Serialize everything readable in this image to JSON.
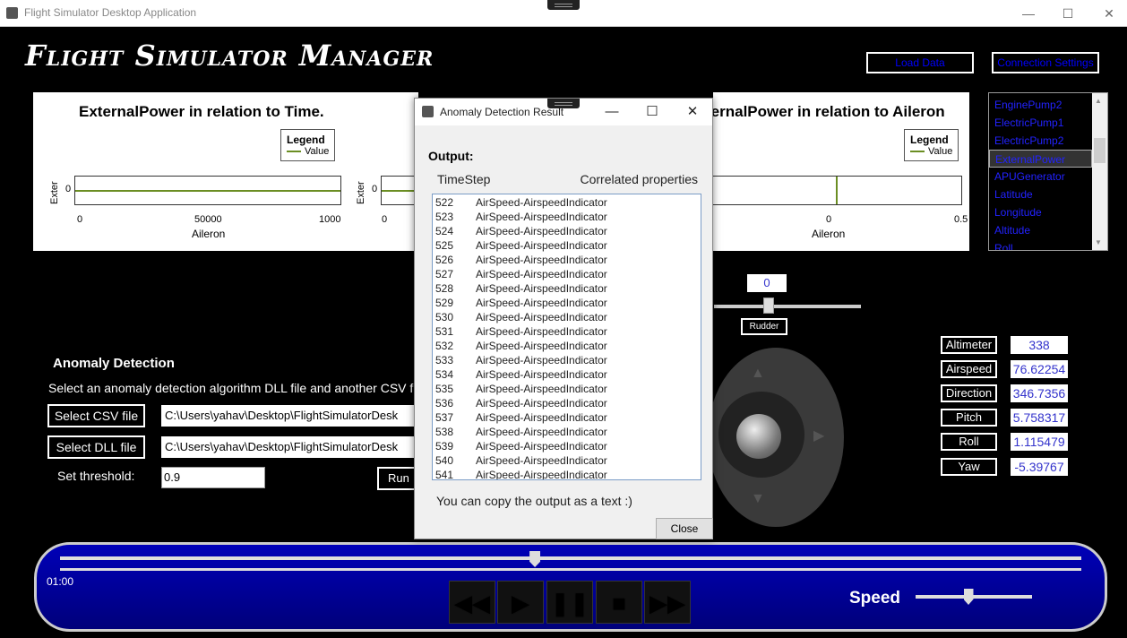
{
  "window": {
    "title": "Flight Simulator Desktop Application",
    "minimize": "—",
    "maximize": "☐",
    "close": "✕"
  },
  "header": {
    "title": "Flight Simulator Manager",
    "load_data": "Load Data",
    "connection_settings": "Connection Settings"
  },
  "chart_data": [
    {
      "type": "line",
      "title": "ExternalPower in relation to Time.",
      "xlabel": "Aileron",
      "ylabel": "Exter",
      "x_ticks": [
        "0",
        "50000",
        "1000"
      ],
      "y_ticks": [
        "0"
      ],
      "legend": {
        "title": "Legend",
        "entries": [
          "Value"
        ]
      },
      "series": [
        {
          "name": "Value",
          "x": [
            0,
            100000
          ],
          "y": [
            0,
            0
          ]
        }
      ]
    },
    {
      "type": "line",
      "title": "",
      "xlabel": "",
      "ylabel": "Exter",
      "x_ticks": [
        "0"
      ],
      "y_ticks": [
        "0"
      ],
      "series": [
        {
          "x": [
            0
          ],
          "y": [
            0
          ]
        }
      ]
    },
    {
      "type": "line",
      "title": "ternalPower in relation to Aileron",
      "xlabel": "Aileron",
      "ylabel": "",
      "x_ticks": [
        "0",
        "0.5"
      ],
      "y_ticks": [],
      "legend": {
        "title": "Legend",
        "entries": [
          "Value"
        ]
      },
      "series": [
        {
          "name": "Value",
          "x": [
            0,
            0
          ],
          "y": [
            0,
            1
          ]
        }
      ]
    }
  ],
  "properties": {
    "items": [
      "EnginePump2",
      "ElectricPump1",
      "ElectricPump2",
      "ExternalPower",
      "APUGenerator",
      "Latitude",
      "Longitude",
      "Altitude",
      "Roll"
    ],
    "selected_index": 3
  },
  "rudder": {
    "value": "0",
    "label": "Rudder"
  },
  "telemetry": [
    {
      "label": "Altimeter",
      "value": "338"
    },
    {
      "label": "Airspeed",
      "value": "76.62254"
    },
    {
      "label": "Direction",
      "value": "346.7356"
    },
    {
      "label": "Pitch",
      "value": "5.758317"
    },
    {
      "label": "Roll",
      "value": "1.115479"
    },
    {
      "label": "Yaw",
      "value": "-5.39767"
    }
  ],
  "anomaly": {
    "title": "Anomaly Detection",
    "description": "Select an anomaly detection algorithm DLL file and another CSV fi",
    "select_csv": "Select CSV file",
    "select_dll": "Select DLL file",
    "csv_path": "C:\\Users\\yahav\\Desktop\\FlightSimulatorDesk",
    "dll_path": "C:\\Users\\yahav\\Desktop\\FlightSimulatorDesk",
    "threshold_label": "Set threshold:",
    "threshold_value": "0.9",
    "run_label": "Run A"
  },
  "player": {
    "time": "01:00",
    "speed_label": "Speed",
    "buttons": [
      "rewind",
      "play",
      "pause",
      "stop",
      "fast-forward"
    ],
    "seek_position": 0.465,
    "speed_position": 0.45
  },
  "dialog": {
    "title": "Anomaly Detection Result",
    "output_label": "Output:",
    "col_timestep": "TimeStep",
    "col_props": "Correlated properties",
    "rows": [
      {
        "t": "522",
        "p": "AirSpeed-AirspeedIndicator"
      },
      {
        "t": "523",
        "p": "AirSpeed-AirspeedIndicator"
      },
      {
        "t": "524",
        "p": "AirSpeed-AirspeedIndicator"
      },
      {
        "t": "525",
        "p": "AirSpeed-AirspeedIndicator"
      },
      {
        "t": "526",
        "p": "AirSpeed-AirspeedIndicator"
      },
      {
        "t": "527",
        "p": "AirSpeed-AirspeedIndicator"
      },
      {
        "t": "528",
        "p": "AirSpeed-AirspeedIndicator"
      },
      {
        "t": "529",
        "p": "AirSpeed-AirspeedIndicator"
      },
      {
        "t": "530",
        "p": "AirSpeed-AirspeedIndicator"
      },
      {
        "t": "531",
        "p": "AirSpeed-AirspeedIndicator"
      },
      {
        "t": "532",
        "p": "AirSpeed-AirspeedIndicator"
      },
      {
        "t": "533",
        "p": "AirSpeed-AirspeedIndicator"
      },
      {
        "t": "534",
        "p": "AirSpeed-AirspeedIndicator"
      },
      {
        "t": "535",
        "p": "AirSpeed-AirspeedIndicator"
      },
      {
        "t": "536",
        "p": "AirSpeed-AirspeedIndicator"
      },
      {
        "t": "537",
        "p": "AirSpeed-AirspeedIndicator"
      },
      {
        "t": "538",
        "p": "AirSpeed-AirspeedIndicator"
      },
      {
        "t": "539",
        "p": "AirSpeed-AirspeedIndicator"
      },
      {
        "t": "540",
        "p": "AirSpeed-AirspeedIndicator"
      },
      {
        "t": "541",
        "p": "AirSpeed-AirspeedIndicator"
      }
    ],
    "copy_note": "You can copy the output as a text :)",
    "close_label": "Close"
  }
}
